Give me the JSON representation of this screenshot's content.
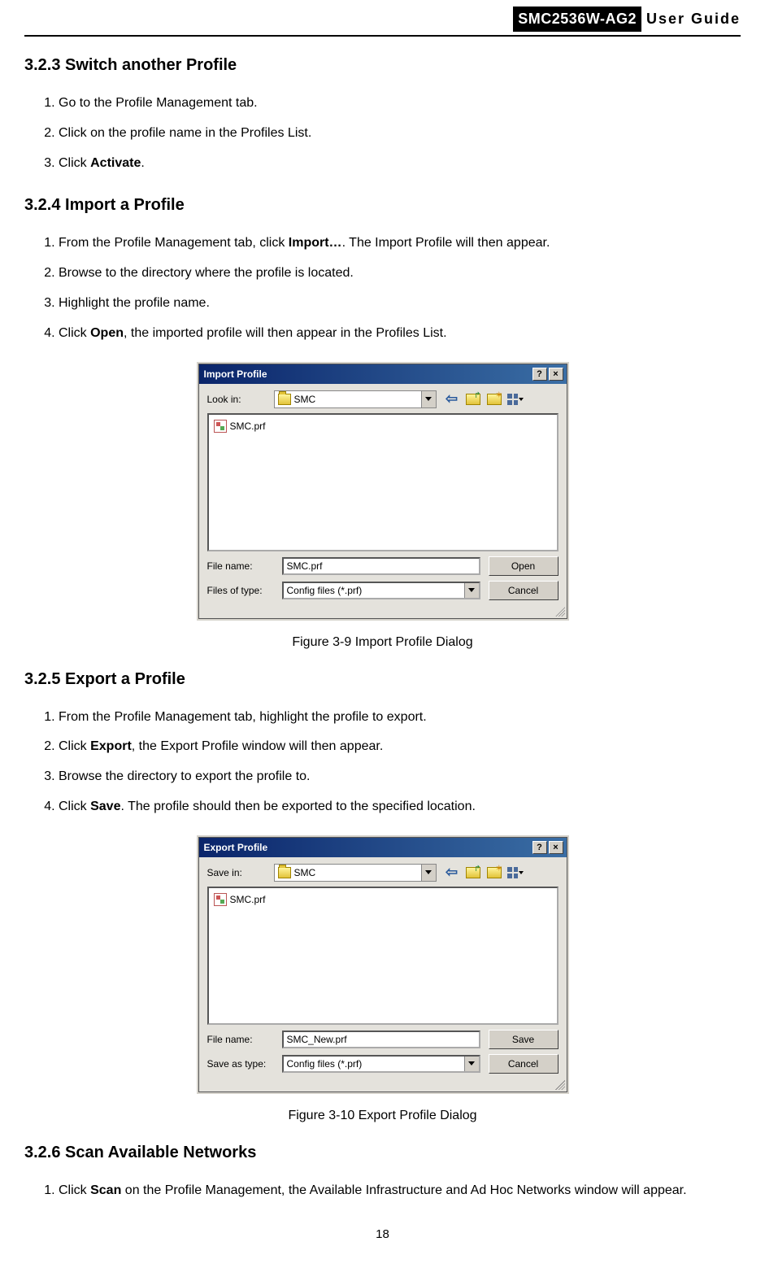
{
  "header": {
    "model": "SMC2536W-AG2",
    "guide": "User  Guide"
  },
  "sections": {
    "s323": {
      "heading": "3.2.3  Switch another Profile",
      "steps": {
        "1": "Go to the Profile Management tab.",
        "2": "Click on the profile name in the Profiles List.",
        "3a": "Click ",
        "3b": "Activate",
        "3c": "."
      }
    },
    "s324": {
      "heading": "3.2.4  Import a Profile",
      "steps": {
        "1a": "From the Profile Management tab, click ",
        "1b": "Import…",
        "1c": ". The Import Profile will then appear.",
        "2": "Browse to the directory where the profile is located.",
        "3": "Highlight the profile name.",
        "4a": "Click ",
        "4b": "Open",
        "4c": ", the imported profile will then appear in the Profiles List."
      }
    },
    "s325": {
      "heading": "3.2.5  Export a Profile",
      "steps": {
        "1": "From the Profile Management tab, highlight the profile to export.",
        "2a": "Click ",
        "2b": "Export",
        "2c": ", the Export Profile window will then appear.",
        "3": "Browse the directory to export the profile to.",
        "4a": "Click ",
        "4b": "Save",
        "4c": ". The profile should then be exported to the specified location."
      }
    },
    "s326": {
      "heading": "3.2.6  Scan Available Networks",
      "steps": {
        "1a": "Click ",
        "1b": "Scan",
        "1c": " on the Profile Management, the Available Infrastructure and Ad Hoc Networks window will appear."
      }
    }
  },
  "dialogs": {
    "import": {
      "title": "Import Profile",
      "look_in_label": "Look in:",
      "look_in_value": "SMC",
      "file_item": "SMC.prf",
      "file_name_label": "File name:",
      "file_name_value": "SMC.prf",
      "type_label": "Files of type:",
      "type_value": "Config files (*.prf)",
      "primary_btn": "Open",
      "cancel_btn": "Cancel",
      "help_glyph": "?",
      "close_glyph": "×"
    },
    "export": {
      "title": "Export Profile",
      "save_in_label": "Save in:",
      "save_in_value": "SMC",
      "file_item": "SMC.prf",
      "file_name_label": "File name:",
      "file_name_value": "SMC_New.prf",
      "type_label": "Save as type:",
      "type_value": "Config files (*.prf)",
      "primary_btn": "Save",
      "cancel_btn": "Cancel",
      "help_glyph": "?",
      "close_glyph": "×"
    }
  },
  "captions": {
    "fig39": "Figure 3-9 Import Profile Dialog",
    "fig310": "Figure 3-10 Export Profile Dialog"
  },
  "page_number": "18"
}
